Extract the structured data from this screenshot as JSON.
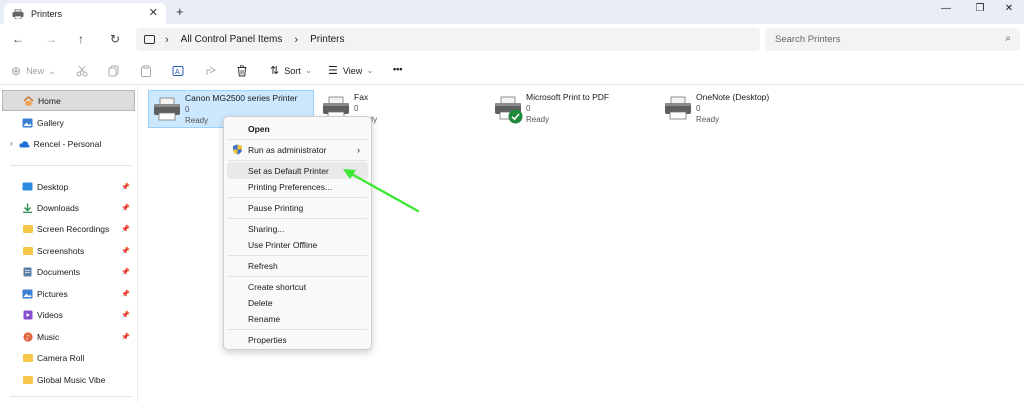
{
  "window": {
    "tab_title": "Printers",
    "tab_close": "✕",
    "new_tab": "+",
    "minimize": "—",
    "restore": "❐",
    "close": "✕"
  },
  "nav": {
    "back": "←",
    "forward": "→",
    "up": "↑",
    "refresh": "↻",
    "breadcrumb": [
      "All Control Panel Items",
      "Printers"
    ],
    "separator": "›",
    "search_placeholder": "Search Printers",
    "search_icon": "⌕"
  },
  "commands": {
    "new_label": "New",
    "new_icon": "⊕",
    "sort_label": "Sort",
    "view_label": "View",
    "more": "•••",
    "chevron": "⌄"
  },
  "sidebar": {
    "home": "Home",
    "gallery": "Gallery",
    "personal": "Rencel - Personal",
    "expand": "›",
    "pinned": [
      "Desktop",
      "Downloads",
      "Screen Recordings",
      "Screenshots",
      "Documents",
      "Pictures",
      "Videos",
      "Music"
    ],
    "unpinned": [
      "Camera Roll",
      "Global Music Vibe"
    ],
    "pin_glyph": "📌"
  },
  "printers": [
    {
      "name": "Canon MG2500 series Printer",
      "count": "0",
      "status": "Ready",
      "selected": true
    },
    {
      "name": "Fax",
      "count": "0",
      "status": "Ready",
      "selected": false
    },
    {
      "name": "Microsoft Print to PDF",
      "count": "0",
      "status": "Ready",
      "default": true
    },
    {
      "name": "OneNote (Desktop)",
      "count": "0",
      "status": "Ready",
      "selected": false
    }
  ],
  "context_menu": {
    "open": "Open",
    "run_as_admin": "Run as administrator",
    "submenu_arrow": "›",
    "set_default": "Set as Default Printer",
    "printing_prefs": "Printing Preferences...",
    "pause": "Pause Printing",
    "sharing": "Sharing...",
    "offline": "Use Printer Offline",
    "refresh": "Refresh",
    "create_shortcut": "Create shortcut",
    "delete": "Delete",
    "rename": "Rename",
    "properties": "Properties"
  },
  "colors": {
    "accent_selection": "#cce8ff",
    "annotation_arrow": "#3ee836",
    "default_check": "#1f8a3a"
  }
}
